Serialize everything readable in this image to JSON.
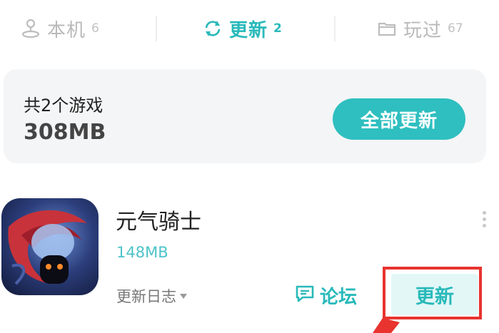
{
  "tabs": [
    {
      "label": "本机",
      "count": "6",
      "icon": "joystick-icon"
    },
    {
      "label": "更新",
      "count": "2",
      "icon": "refresh-icon"
    },
    {
      "label": "玩过",
      "count": "67",
      "icon": "folder-icon"
    }
  ],
  "summary": {
    "text": "共2个游戏",
    "size": "308MB",
    "update_all_label": "全部更新"
  },
  "game": {
    "name": "元气骑士",
    "size": "148MB",
    "changelog_label": "更新日志",
    "forum_label": "论坛",
    "update_label": "更新"
  },
  "colors": {
    "accent": "#29b9ba",
    "highlight": "#e8332f"
  }
}
